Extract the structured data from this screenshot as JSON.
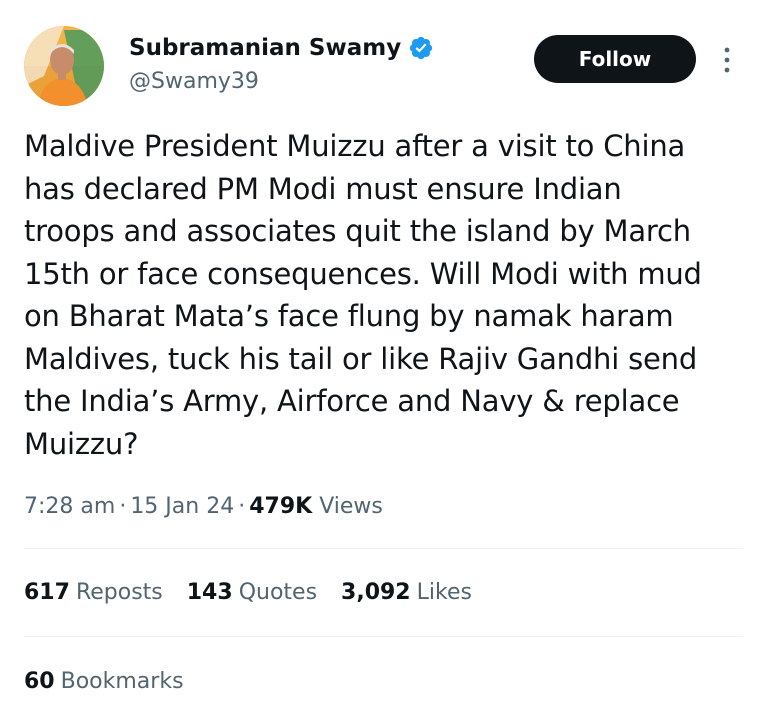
{
  "author": {
    "display_name": "Subramanian Swamy",
    "handle": "@Swamy39",
    "verified": true,
    "avatar_icon": "profile-photo"
  },
  "follow_button": {
    "label": "Follow"
  },
  "more_icon": "more-vertical-icon",
  "tweet": {
    "lines": [
      "Maldive President Muizzu after a visit to China",
      "has declared PM Modi must ensure Indian",
      "troops and associates quit the island by March",
      "15th or face consequences. Will Modi with mud",
      "on Bharat Mata’s face flung by namak haram",
      "Maldives, tuck his tail or like Rajiv Gandhi send",
      "the India’s Army, Airforce and Navy & replace",
      "Muizzu?"
    ]
  },
  "meta": {
    "time": "7:28 am",
    "separator": "·",
    "date": "15 Jan 24",
    "views_count": "479K",
    "views_label": "Views"
  },
  "stats": {
    "reposts": {
      "count": "617",
      "label": "Reposts"
    },
    "quotes": {
      "count": "143",
      "label": "Quotes"
    },
    "likes": {
      "count": "3,092",
      "label": "Likes"
    },
    "bookmarks": {
      "count": "60",
      "label": "Bookmarks"
    }
  },
  "colors": {
    "text_primary": "#0f1419",
    "text_secondary": "#536471",
    "verified_blue": "#1d9bf0",
    "divider": "#eff3f4"
  }
}
